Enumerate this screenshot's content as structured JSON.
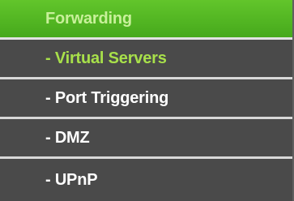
{
  "menu": {
    "header": "Forwarding",
    "items": [
      {
        "label": "- Virtual Servers",
        "active": true
      },
      {
        "label": "- Port Triggering",
        "active": false
      },
      {
        "label": "- DMZ",
        "active": false
      },
      {
        "label": "- UPnP",
        "active": false
      }
    ]
  },
  "colors": {
    "header_bg": "#52b623",
    "active_text": "#a8e04a",
    "normal_text": "#ffffff",
    "item_bg": "#4a4a4a",
    "divider": "#d8d8d8"
  }
}
